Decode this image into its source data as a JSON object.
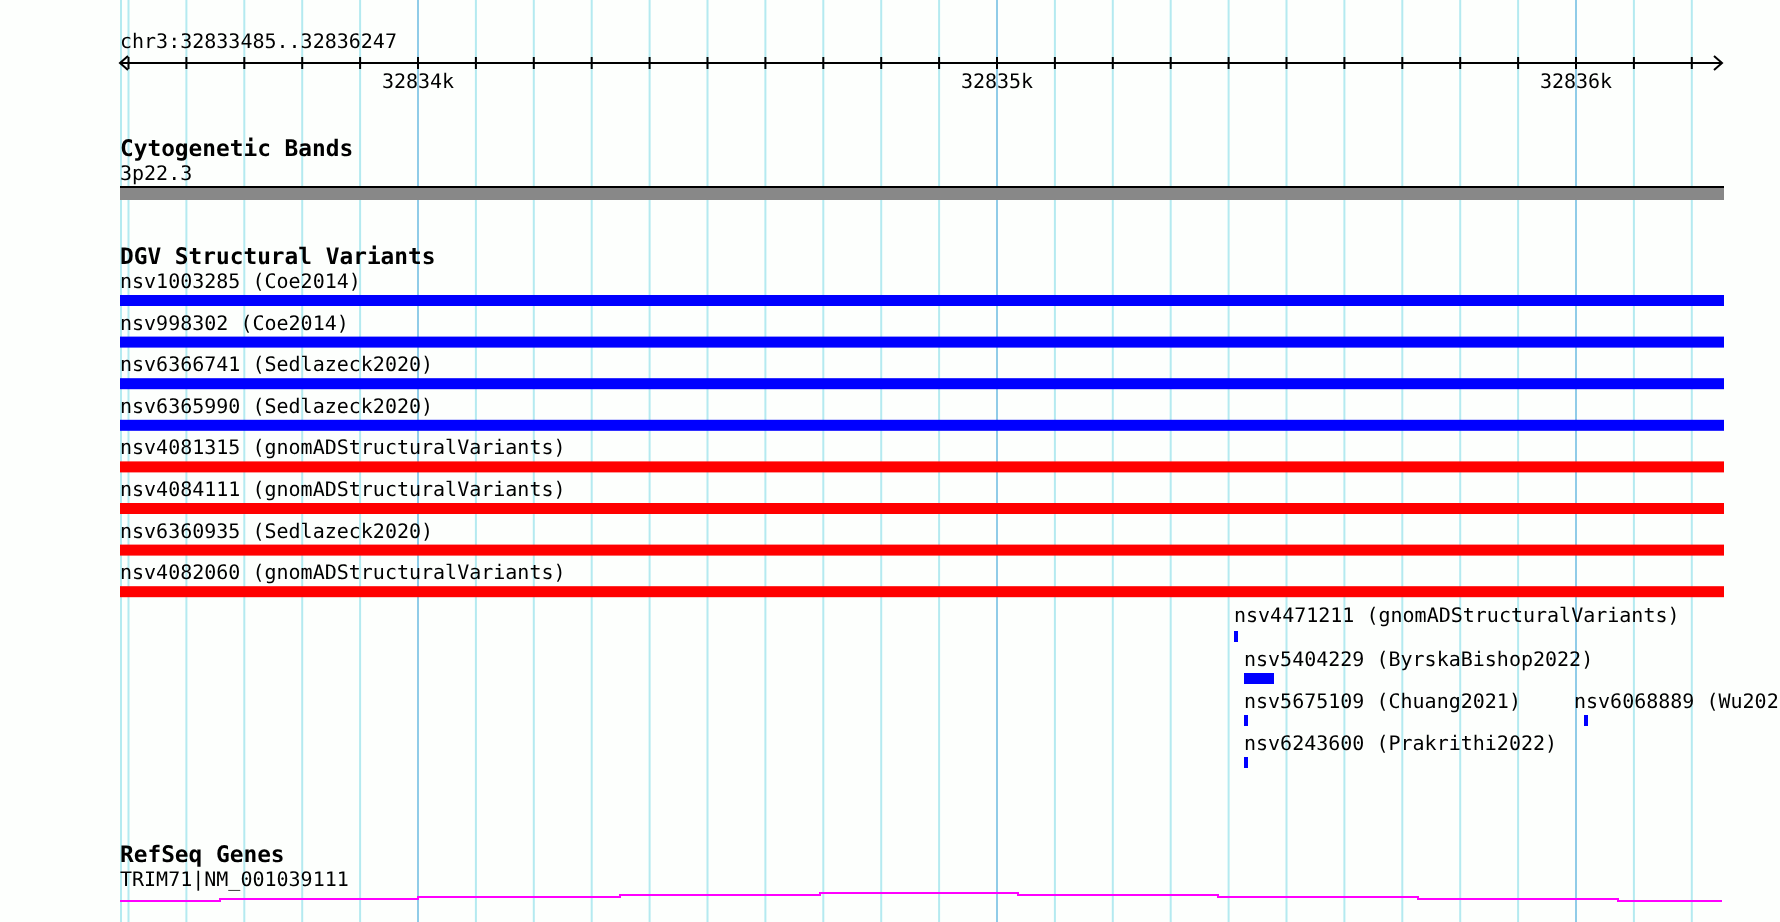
{
  "ruler": {
    "position": "chr3:32833485..32836247",
    "tick_labels": [
      "32834k",
      "32835k",
      "32836k"
    ]
  },
  "cytogenetic_bands": {
    "title": "Cytogenetic Bands",
    "band": {
      "label": "3p22.3"
    }
  },
  "dgv_structural_variants": {
    "title": "DGV Structural Variants",
    "variants": [
      {
        "label": "nsv1003285 (Coe2014)",
        "color": "#0000ff"
      },
      {
        "label": "nsv998302 (Coe2014)",
        "color": "#0000ff"
      },
      {
        "label": "nsv6366741 (Sedlazeck2020)",
        "color": "#0000ff"
      },
      {
        "label": "nsv6365990 (Sedlazeck2020)",
        "color": "#0000ff"
      },
      {
        "label": "nsv4081315 (gnomADStructuralVariants)",
        "color": "#ff0000"
      },
      {
        "label": "nsv4084111 (gnomADStructuralVariants)",
        "color": "#ff0000"
      },
      {
        "label": "nsv6360935 (Sedlazeck2020)",
        "color": "#ff0000"
      },
      {
        "label": "nsv4082060 (gnomADStructuralVariants)",
        "color": "#ff0000"
      },
      {
        "label": "nsv4471211 (gnomADStructuralVariants)",
        "color": "#0000ff"
      },
      {
        "label": "nsv5404229 (ByrskaBishop2022)",
        "color": "#0000ff"
      },
      {
        "label": "nsv5675109 (Chuang2021)",
        "color": "#0000ff"
      },
      {
        "label": "nsv6068889 (Wu202",
        "color": "#0000ff"
      },
      {
        "label": "nsv6243600 (Prakrithi2022)",
        "color": "#0000ff"
      }
    ]
  },
  "refseq_genes": {
    "title": "RefSeq Genes",
    "gene": {
      "label": "TRIM71|NM_001039111"
    }
  }
}
